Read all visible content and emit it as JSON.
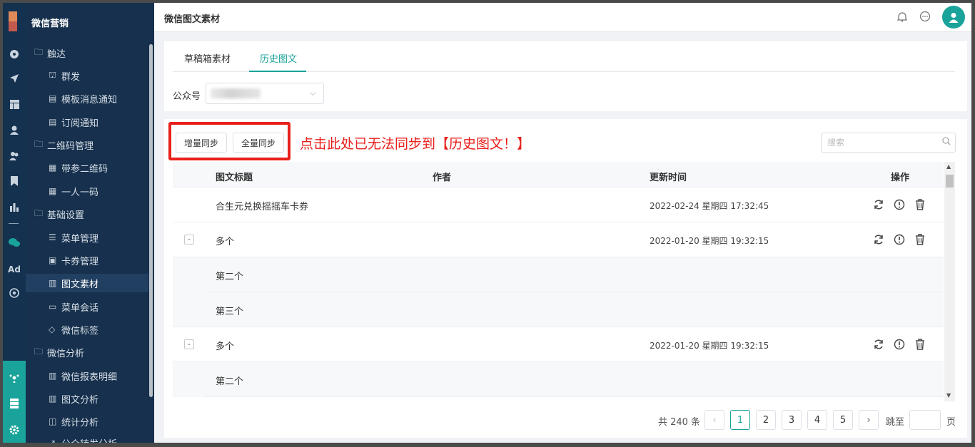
{
  "menu": {
    "brand": "微信营销",
    "items": [
      {
        "label": "触达",
        "icon": "folder-icon"
      },
      {
        "label": "群发",
        "icon": "broadcast-icon"
      },
      {
        "label": "模板消息通知",
        "icon": "message-icon"
      },
      {
        "label": "订阅通知",
        "icon": "message-icon"
      },
      {
        "label": "二维码管理",
        "icon": "folder-icon"
      },
      {
        "label": "带参二维码",
        "icon": "qrcode-icon"
      },
      {
        "label": "一人一码",
        "icon": "qrcode-icon"
      },
      {
        "label": "基础设置",
        "icon": "folder-icon"
      },
      {
        "label": "菜单管理",
        "icon": "list-icon"
      },
      {
        "label": "卡券管理",
        "icon": "coupon-icon"
      },
      {
        "label": "图文素材",
        "icon": "document-icon"
      },
      {
        "label": "菜单会话",
        "icon": "chat-icon"
      },
      {
        "label": "微信标签",
        "icon": "tag-icon"
      },
      {
        "label": "微信分析",
        "icon": "folder-icon"
      },
      {
        "label": "微信报表明细",
        "icon": "report-icon"
      },
      {
        "label": "图文分析",
        "icon": "report-icon"
      },
      {
        "label": "统计分析",
        "icon": "chart-icon"
      },
      {
        "label": "公众转发分析",
        "icon": "share-icon"
      }
    ]
  },
  "rail": {
    "ad_label": "Ad"
  },
  "topbar": {
    "title": "微信图文素材"
  },
  "tabs": [
    {
      "label": "草稿箱素材"
    },
    {
      "label": "历史图文"
    }
  ],
  "account": {
    "label": "公众号"
  },
  "toolbar": {
    "incremental_sync": "增量同步",
    "full_sync": "全量同步",
    "annotation": "点击此处已无法同步到【历史图文！】",
    "search_placeholder": "搜索"
  },
  "table": {
    "headers": {
      "title": "图文标题",
      "author": "作者",
      "updated": "更新时间",
      "actions": "操作"
    },
    "rows": [
      {
        "toggle": "",
        "title": "合生元兑换摇摇车卡券",
        "author": "",
        "updated": "2022-02-24 星期四 17:32:45"
      },
      {
        "toggle": "-",
        "title": "多个",
        "author": "",
        "updated": "2022-01-20 星期四 19:32:15"
      },
      {
        "toggle": "",
        "title": "第二个",
        "author": "",
        "updated": ""
      },
      {
        "toggle": "",
        "title": "第三个",
        "author": "",
        "updated": ""
      },
      {
        "toggle": "-",
        "title": "多个",
        "author": "",
        "updated": "2022-01-20 星期四 19:32:15"
      },
      {
        "toggle": "",
        "title": "第二个",
        "author": "",
        "updated": ""
      }
    ]
  },
  "pagination": {
    "total": "共 240 条",
    "pages": [
      "1",
      "2",
      "3",
      "4",
      "5"
    ],
    "current": "1",
    "jump_label": "跳至",
    "page_unit": "页"
  },
  "colors": {
    "accent": "#1aa39a",
    "sidebar": "#16304d",
    "annotation": "#e8201b"
  }
}
